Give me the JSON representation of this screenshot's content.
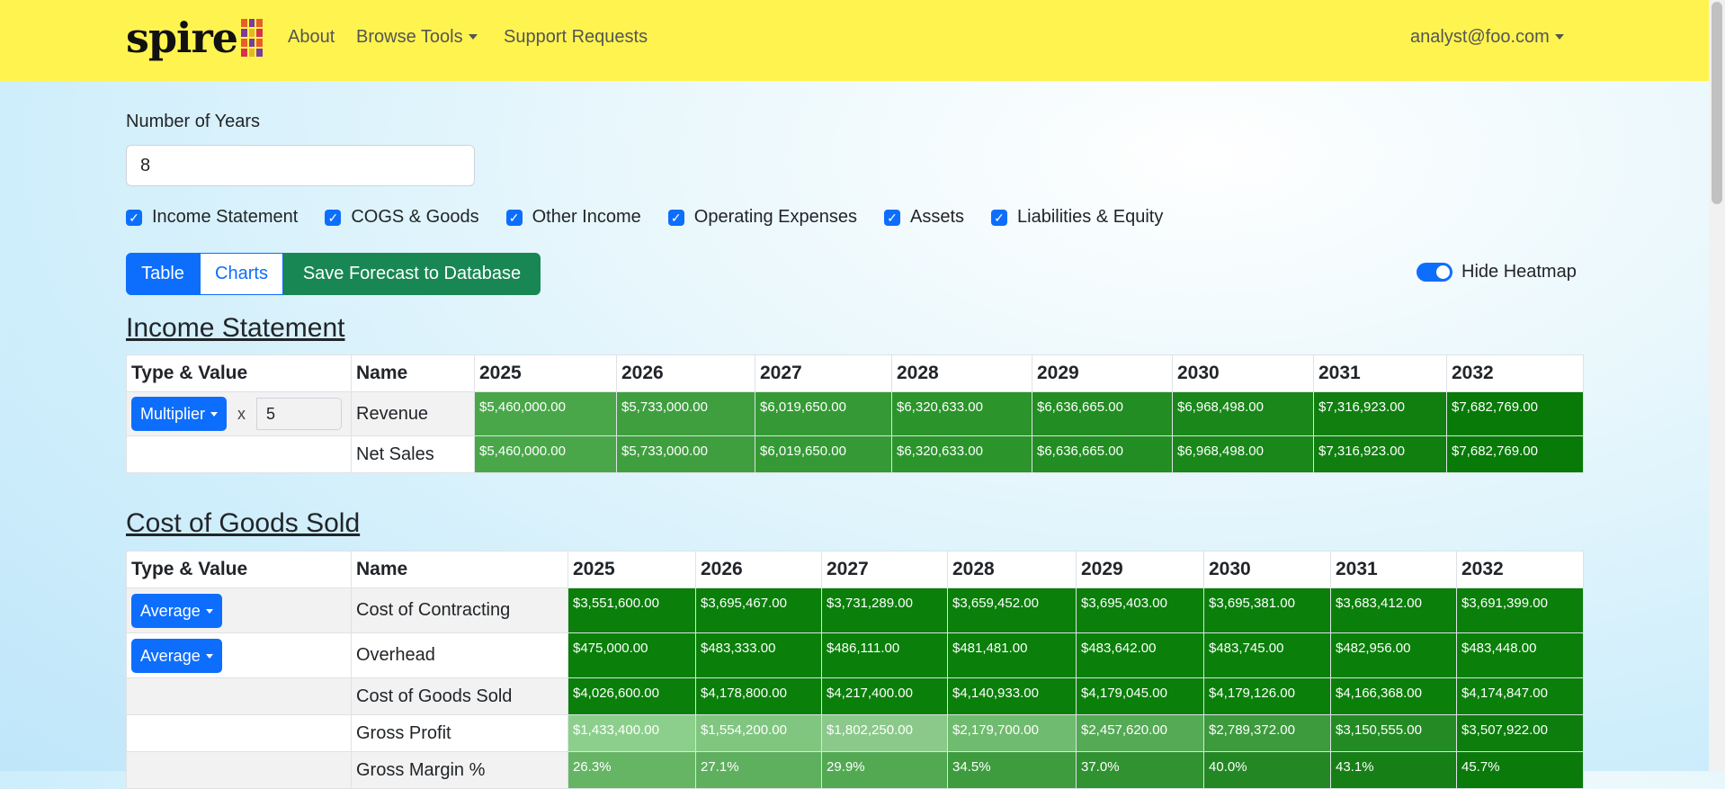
{
  "nav": {
    "brand": "spire",
    "links": [
      "About",
      "Browse Tools",
      "Support Requests"
    ],
    "user": "analyst@foo.com"
  },
  "form": {
    "years_label": "Number of Years",
    "years_value": "8",
    "checkboxes": [
      "Income Statement",
      "COGS & Goods",
      "Other Income",
      "Operating Expenses",
      "Assets",
      "Liabilities & Equity"
    ]
  },
  "buttons": {
    "table": "Table",
    "charts": "Charts",
    "save": "Save Forecast to Database"
  },
  "heatmap_toggle": {
    "label": "Hide Heatmap",
    "on": true
  },
  "income": {
    "title": "Income Statement",
    "headers": [
      "Type & Value",
      "Name",
      "2025",
      "2026",
      "2027",
      "2028",
      "2029",
      "2030",
      "2031",
      "2032"
    ],
    "rows": [
      {
        "type": "Multiplier",
        "x": "x",
        "value": "5",
        "name": "Revenue",
        "values": [
          "$5,460,000.00",
          "$5,733,000.00",
          "$6,019,650.00",
          "$6,320,633.00",
          "$6,636,665.00",
          "$6,968,498.00",
          "$7,316,923.00",
          "$7,682,769.00"
        ]
      },
      {
        "name": "Net Sales",
        "values": [
          "$5,460,000.00",
          "$5,733,000.00",
          "$6,019,650.00",
          "$6,320,633.00",
          "$6,636,665.00",
          "$6,968,498.00",
          "$7,316,923.00",
          "$7,682,769.00"
        ]
      }
    ]
  },
  "cogs": {
    "title": "Cost of Goods Sold",
    "headers": [
      "Type & Value",
      "Name",
      "2025",
      "2026",
      "2027",
      "2028",
      "2029",
      "2030",
      "2031",
      "2032"
    ],
    "rows": [
      {
        "type": "Average",
        "name": "Cost of Contracting",
        "values": [
          "$3,551,600.00",
          "$3,695,467.00",
          "$3,731,289.00",
          "$3,659,452.00",
          "$3,695,403.00",
          "$3,695,381.00",
          "$3,683,412.00",
          "$3,691,399.00"
        ]
      },
      {
        "type": "Average",
        "name": "Overhead",
        "values": [
          "$475,000.00",
          "$483,333.00",
          "$486,111.00",
          "$481,481.00",
          "$483,642.00",
          "$483,745.00",
          "$482,956.00",
          "$483,448.00"
        ]
      },
      {
        "name": "Cost of Goods Sold",
        "values": [
          "$4,026,600.00",
          "$4,178,800.00",
          "$4,217,400.00",
          "$4,140,933.00",
          "$4,179,045.00",
          "$4,179,126.00",
          "$4,166,368.00",
          "$4,174,847.00"
        ]
      },
      {
        "name": "Gross Profit",
        "values": [
          "$1,433,400.00",
          "$1,554,200.00",
          "$1,802,250.00",
          "$2,179,700.00",
          "$2,457,620.00",
          "$2,789,372.00",
          "$3,150,555.00",
          "$3,507,922.00"
        ]
      },
      {
        "name": "Gross Margin %",
        "values": [
          "26.3%",
          "27.1%",
          "29.9%",
          "34.5%",
          "37.0%",
          "40.0%",
          "43.1%",
          "45.7%"
        ]
      }
    ]
  },
  "colors": {
    "nav_bg": "#fff44f",
    "primary": "#0d6efd",
    "success": "#198754",
    "heat_dark": "#0a7f0a",
    "heat_light": "#8ccf8c"
  }
}
